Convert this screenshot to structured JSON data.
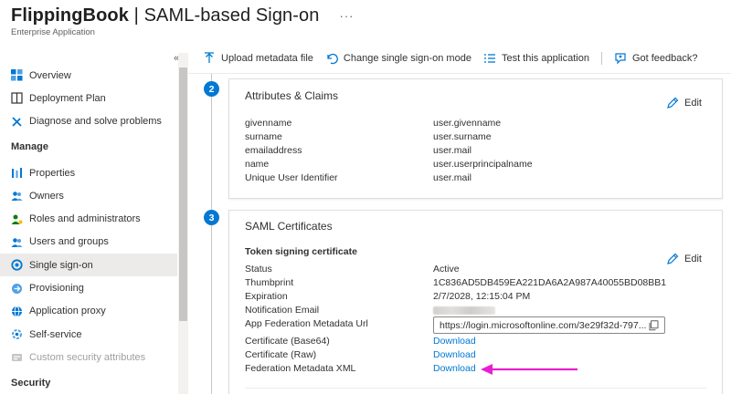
{
  "header": {
    "title": "FlippingBook",
    "title_sep": " | ",
    "subtitle_main": "SAML-based Sign-on",
    "more": "···",
    "app_type": "Enterprise Application"
  },
  "sidebar": {
    "collapse": "«",
    "items": [
      {
        "label": "Overview",
        "icon": "grid-icon"
      },
      {
        "label": "Deployment Plan",
        "icon": "book-icon"
      },
      {
        "label": "Diagnose and solve problems",
        "icon": "wrench-icon"
      }
    ],
    "manage_heading": "Manage",
    "manage_items": [
      {
        "label": "Properties",
        "icon": "properties-icon"
      },
      {
        "label": "Owners",
        "icon": "owners-icon"
      },
      {
        "label": "Roles and administrators",
        "icon": "roles-icon"
      },
      {
        "label": "Users and groups",
        "icon": "users-icon"
      },
      {
        "label": "Single sign-on",
        "icon": "sso-icon",
        "active": true
      },
      {
        "label": "Provisioning",
        "icon": "provisioning-icon"
      },
      {
        "label": "Application proxy",
        "icon": "proxy-icon"
      },
      {
        "label": "Self-service",
        "icon": "self-service-icon"
      },
      {
        "label": "Custom security attributes",
        "icon": "security-attributes-icon",
        "disabled": true
      }
    ],
    "security_heading": "Security"
  },
  "toolbar": {
    "upload": "Upload metadata file",
    "change_mode": "Change single sign-on mode",
    "test": "Test this application",
    "feedback": "Got feedback?"
  },
  "steps": {
    "attributes": "2",
    "certificates": "3"
  },
  "attributes_card": {
    "title": "Attributes & Claims",
    "edit": "Edit",
    "rows": [
      {
        "k": "givenname",
        "v": "user.givenname"
      },
      {
        "k": "surname",
        "v": "user.surname"
      },
      {
        "k": "emailaddress",
        "v": "user.mail"
      },
      {
        "k": "name",
        "v": "user.userprincipalname"
      },
      {
        "k": "Unique User Identifier",
        "v": "user.mail"
      }
    ]
  },
  "cert_card": {
    "title": "SAML Certificates",
    "subhead": "Token signing certificate",
    "edit": "Edit",
    "status_k": "Status",
    "status_v": "Active",
    "thumb_k": "Thumbprint",
    "thumb_v": "1C836AD5DB459EA221DA6A2A987A40055BD08BB1",
    "exp_k": "Expiration",
    "exp_v": "2/7/2028, 12:15:04 PM",
    "notif_k": "Notification Email",
    "url_k": "App Federation Metadata Url",
    "url_v": "https://login.microsoftonline.com/3e29f32d-797...",
    "b64_k": "Certificate (Base64)",
    "b64_v": "Download",
    "raw_k": "Certificate (Raw)",
    "raw_v": "Download",
    "fed_k": "Federation Metadata XML",
    "fed_v": "Download"
  },
  "colors": {
    "accent": "#0078d4",
    "annotation_arrow": "#e81fd0"
  }
}
